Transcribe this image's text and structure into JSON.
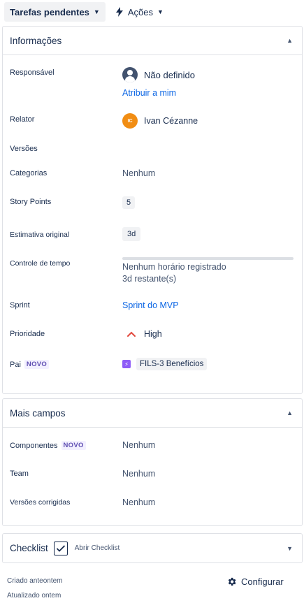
{
  "toolbar": {
    "status_label": "Tarefas pendentes",
    "actions_label": "Ações"
  },
  "info": {
    "title": "Informações",
    "assignee": {
      "label": "Responsável",
      "value": "Não definido",
      "assign_link": "Atribuir a mim"
    },
    "reporter": {
      "label": "Relator",
      "initials": "IC",
      "value": "Ivan Cézanne"
    },
    "versions": {
      "label": "Versões"
    },
    "categories": {
      "label": "Categorias",
      "value": "Nenhum"
    },
    "story_points": {
      "label": "Story Points",
      "value": "5"
    },
    "estimate": {
      "label": "Estimativa original",
      "value": "3d"
    },
    "time_tracking": {
      "label": "Controle de tempo",
      "logged": "Nenhum horário registrado",
      "remaining": "3d restante(s)",
      "progress": 0
    },
    "sprint": {
      "label": "Sprint",
      "value": "Sprint do MVP"
    },
    "priority": {
      "label": "Prioridade",
      "value": "High"
    },
    "parent": {
      "label": "Pai",
      "badge": "NOVO",
      "value": "FILS-3 Benefícios"
    }
  },
  "more_fields": {
    "title": "Mais campos",
    "components": {
      "label": "Componentes",
      "badge": "NOVO",
      "value": "Nenhum"
    },
    "team": {
      "label": "Team",
      "value": "Nenhum"
    },
    "fix_versions": {
      "label": "Versões corrigidas",
      "value": "Nenhum"
    }
  },
  "checklist": {
    "title": "Checklist",
    "open_label": "Abrir Checklist"
  },
  "footer": {
    "created": "Criado anteontem",
    "updated": "Atualizado ontem",
    "configure": "Configurar"
  },
  "colors": {
    "link": "#0c66e4",
    "new_badge": "#5e4db2",
    "priority_high": "#e2483d",
    "epic": "#8f5cf7",
    "reporter_avatar": "#f18d13"
  },
  "icons": {
    "status_chevron": "chevron-down-icon",
    "actions": "lightning-icon",
    "collapse": "chevron-up-icon",
    "priority": "priority-high-icon",
    "settings": "gear-icon"
  }
}
